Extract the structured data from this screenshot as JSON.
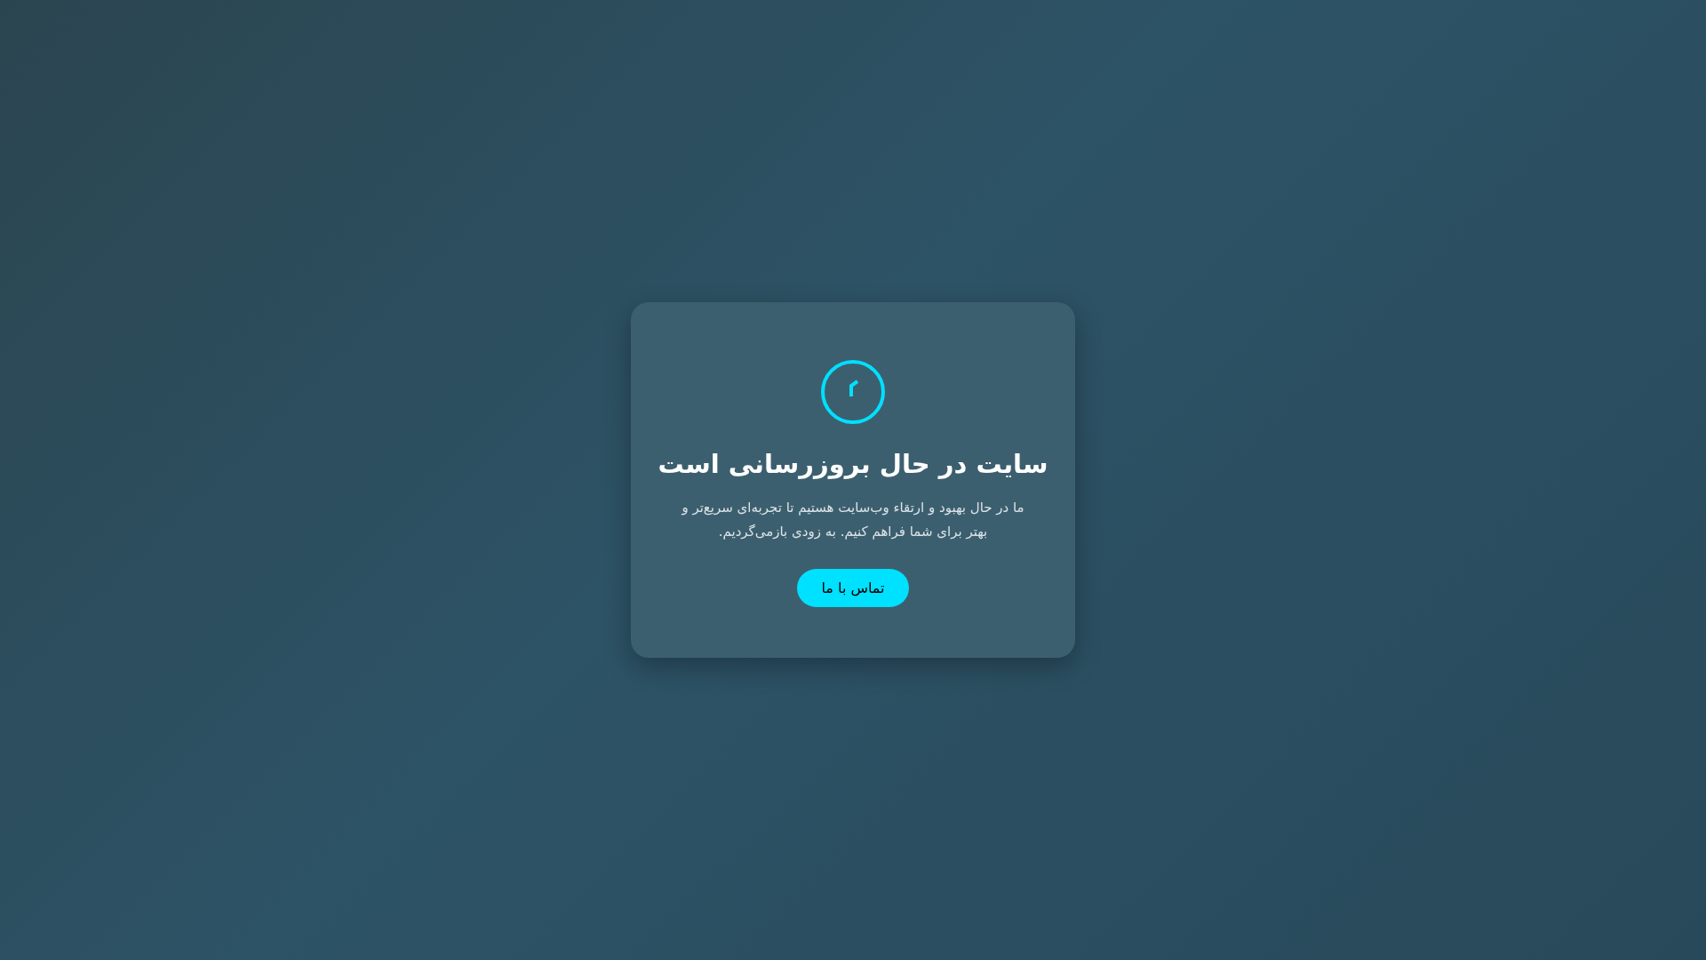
{
  "card": {
    "title": "سایت در حال بروزرسانی است",
    "message": "ما در حال بهبود و ارتقاء وب‌سایت هستیم تا تجربه‌ای سریع‌تر و بهتر برای شما فراهم کنیم. به زودی بازمی‌گردیم.",
    "button": "تماس با ما"
  }
}
